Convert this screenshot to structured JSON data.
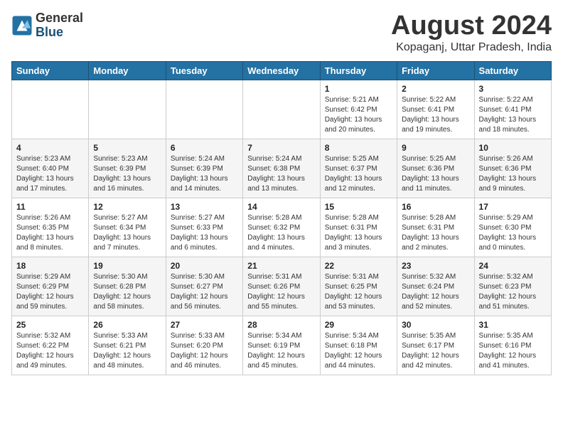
{
  "logo": {
    "general": "General",
    "blue": "Blue"
  },
  "header": {
    "month": "August 2024",
    "location": "Kopaganj, Uttar Pradesh, India"
  },
  "days_of_week": [
    "Sunday",
    "Monday",
    "Tuesday",
    "Wednesday",
    "Thursday",
    "Friday",
    "Saturday"
  ],
  "weeks": [
    [
      {
        "day": "",
        "info": ""
      },
      {
        "day": "",
        "info": ""
      },
      {
        "day": "",
        "info": ""
      },
      {
        "day": "",
        "info": ""
      },
      {
        "day": "1",
        "info": "Sunrise: 5:21 AM\nSunset: 6:42 PM\nDaylight: 13 hours\nand 20 minutes."
      },
      {
        "day": "2",
        "info": "Sunrise: 5:22 AM\nSunset: 6:41 PM\nDaylight: 13 hours\nand 19 minutes."
      },
      {
        "day": "3",
        "info": "Sunrise: 5:22 AM\nSunset: 6:41 PM\nDaylight: 13 hours\nand 18 minutes."
      }
    ],
    [
      {
        "day": "4",
        "info": "Sunrise: 5:23 AM\nSunset: 6:40 PM\nDaylight: 13 hours\nand 17 minutes."
      },
      {
        "day": "5",
        "info": "Sunrise: 5:23 AM\nSunset: 6:39 PM\nDaylight: 13 hours\nand 16 minutes."
      },
      {
        "day": "6",
        "info": "Sunrise: 5:24 AM\nSunset: 6:39 PM\nDaylight: 13 hours\nand 14 minutes."
      },
      {
        "day": "7",
        "info": "Sunrise: 5:24 AM\nSunset: 6:38 PM\nDaylight: 13 hours\nand 13 minutes."
      },
      {
        "day": "8",
        "info": "Sunrise: 5:25 AM\nSunset: 6:37 PM\nDaylight: 13 hours\nand 12 minutes."
      },
      {
        "day": "9",
        "info": "Sunrise: 5:25 AM\nSunset: 6:36 PM\nDaylight: 13 hours\nand 11 minutes."
      },
      {
        "day": "10",
        "info": "Sunrise: 5:26 AM\nSunset: 6:36 PM\nDaylight: 13 hours\nand 9 minutes."
      }
    ],
    [
      {
        "day": "11",
        "info": "Sunrise: 5:26 AM\nSunset: 6:35 PM\nDaylight: 13 hours\nand 8 minutes."
      },
      {
        "day": "12",
        "info": "Sunrise: 5:27 AM\nSunset: 6:34 PM\nDaylight: 13 hours\nand 7 minutes."
      },
      {
        "day": "13",
        "info": "Sunrise: 5:27 AM\nSunset: 6:33 PM\nDaylight: 13 hours\nand 6 minutes."
      },
      {
        "day": "14",
        "info": "Sunrise: 5:28 AM\nSunset: 6:32 PM\nDaylight: 13 hours\nand 4 minutes."
      },
      {
        "day": "15",
        "info": "Sunrise: 5:28 AM\nSunset: 6:31 PM\nDaylight: 13 hours\nand 3 minutes."
      },
      {
        "day": "16",
        "info": "Sunrise: 5:28 AM\nSunset: 6:31 PM\nDaylight: 13 hours\nand 2 minutes."
      },
      {
        "day": "17",
        "info": "Sunrise: 5:29 AM\nSunset: 6:30 PM\nDaylight: 13 hours\nand 0 minutes."
      }
    ],
    [
      {
        "day": "18",
        "info": "Sunrise: 5:29 AM\nSunset: 6:29 PM\nDaylight: 12 hours\nand 59 minutes."
      },
      {
        "day": "19",
        "info": "Sunrise: 5:30 AM\nSunset: 6:28 PM\nDaylight: 12 hours\nand 58 minutes."
      },
      {
        "day": "20",
        "info": "Sunrise: 5:30 AM\nSunset: 6:27 PM\nDaylight: 12 hours\nand 56 minutes."
      },
      {
        "day": "21",
        "info": "Sunrise: 5:31 AM\nSunset: 6:26 PM\nDaylight: 12 hours\nand 55 minutes."
      },
      {
        "day": "22",
        "info": "Sunrise: 5:31 AM\nSunset: 6:25 PM\nDaylight: 12 hours\nand 53 minutes."
      },
      {
        "day": "23",
        "info": "Sunrise: 5:32 AM\nSunset: 6:24 PM\nDaylight: 12 hours\nand 52 minutes."
      },
      {
        "day": "24",
        "info": "Sunrise: 5:32 AM\nSunset: 6:23 PM\nDaylight: 12 hours\nand 51 minutes."
      }
    ],
    [
      {
        "day": "25",
        "info": "Sunrise: 5:32 AM\nSunset: 6:22 PM\nDaylight: 12 hours\nand 49 minutes."
      },
      {
        "day": "26",
        "info": "Sunrise: 5:33 AM\nSunset: 6:21 PM\nDaylight: 12 hours\nand 48 minutes."
      },
      {
        "day": "27",
        "info": "Sunrise: 5:33 AM\nSunset: 6:20 PM\nDaylight: 12 hours\nand 46 minutes."
      },
      {
        "day": "28",
        "info": "Sunrise: 5:34 AM\nSunset: 6:19 PM\nDaylight: 12 hours\nand 45 minutes."
      },
      {
        "day": "29",
        "info": "Sunrise: 5:34 AM\nSunset: 6:18 PM\nDaylight: 12 hours\nand 44 minutes."
      },
      {
        "day": "30",
        "info": "Sunrise: 5:35 AM\nSunset: 6:17 PM\nDaylight: 12 hours\nand 42 minutes."
      },
      {
        "day": "31",
        "info": "Sunrise: 5:35 AM\nSunset: 6:16 PM\nDaylight: 12 hours\nand 41 minutes."
      }
    ]
  ]
}
